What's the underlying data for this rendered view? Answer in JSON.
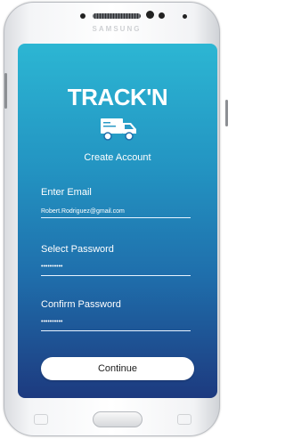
{
  "device": {
    "brand": "SAMSUNG"
  },
  "app": {
    "logo_text": "TRACK'N",
    "logo_icon": "truck-icon",
    "subtitle": "Create Account"
  },
  "form": {
    "email_label": "Enter Email",
    "email_value": "Robert.Rodriguez@gmail.com",
    "password_label": "Select Password",
    "password_value": "••••••••••",
    "confirm_label": "Confirm Password",
    "confirm_value": "••••••••••"
  },
  "buttons": {
    "continue_label": "Continue"
  },
  "colors": {
    "gradient_top": "#2cb6d3",
    "gradient_bottom": "#1d3a7f",
    "text": "#ffffff",
    "button_bg": "#ffffff"
  }
}
